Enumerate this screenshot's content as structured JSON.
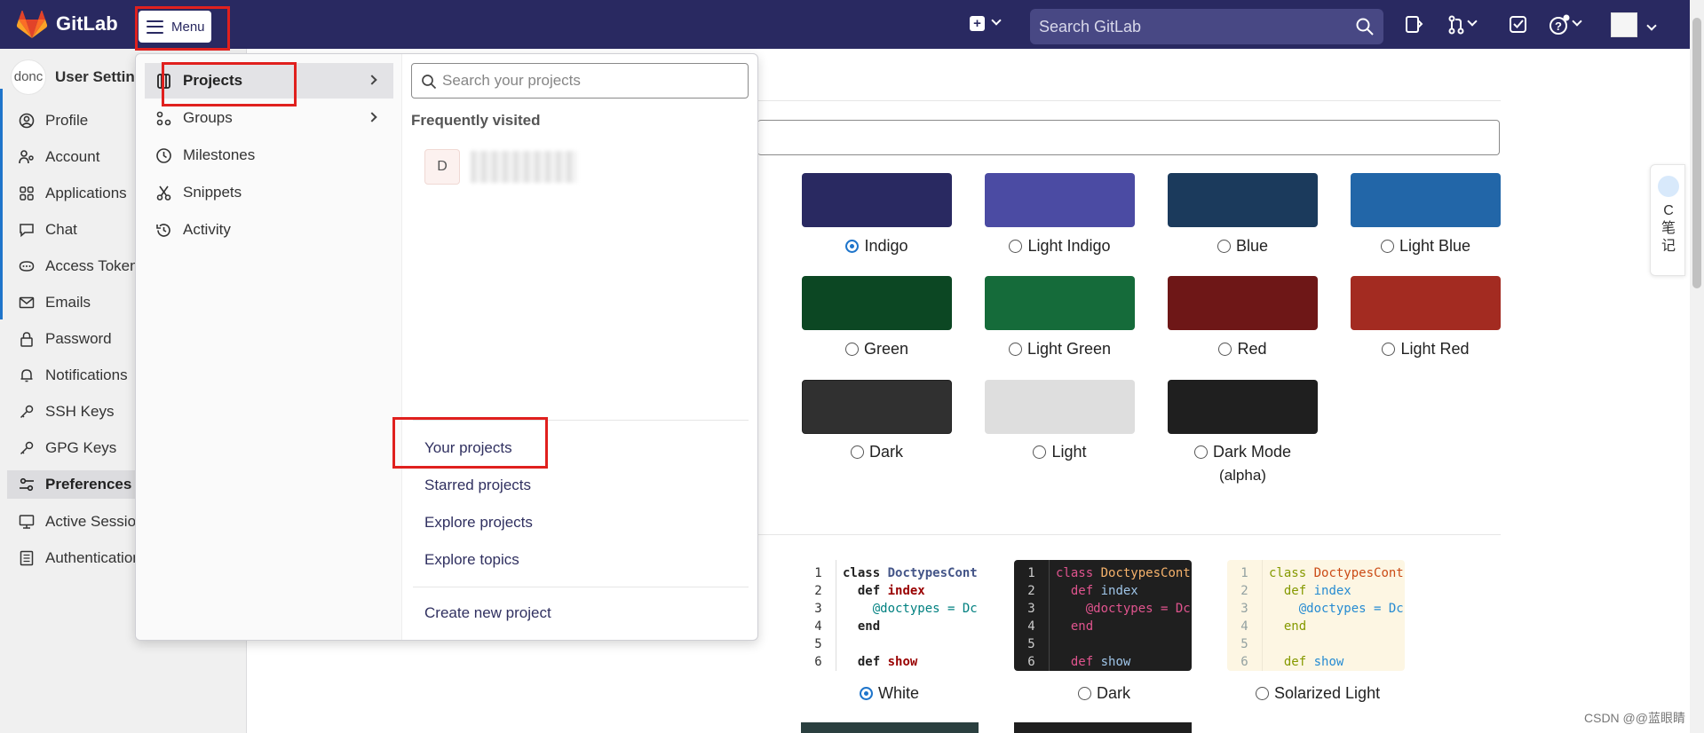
{
  "topbar": {
    "brand": "GitLab",
    "menu_label": "Menu",
    "search_placeholder": "Search GitLab"
  },
  "sidebar": {
    "user_title": "User Settings",
    "avatar_text": "donc",
    "items": [
      {
        "label": "Profile"
      },
      {
        "label": "Account"
      },
      {
        "label": "Applications"
      },
      {
        "label": "Chat"
      },
      {
        "label": "Access Tokens"
      },
      {
        "label": "Emails"
      },
      {
        "label": "Password"
      },
      {
        "label": "Notifications"
      },
      {
        "label": "SSH Keys"
      },
      {
        "label": "GPG Keys"
      },
      {
        "label": "Preferences"
      },
      {
        "label": "Active Sessions"
      },
      {
        "label": "Authentication"
      }
    ]
  },
  "menu": {
    "items": [
      {
        "label": "Projects"
      },
      {
        "label": "Groups"
      },
      {
        "label": "Milestones"
      },
      {
        "label": "Snippets"
      },
      {
        "label": "Activity"
      }
    ],
    "search_placeholder": "Search your projects",
    "frequently_visited": "Frequently visited",
    "frequent_project_initial": "D",
    "links": {
      "your_projects": "Your projects",
      "starred_projects": "Starred projects",
      "explore_projects": "Explore projects",
      "explore_topics": "Explore topics",
      "create_new_project": "Create new project"
    }
  },
  "themes": [
    {
      "label": "Indigo",
      "color": "#292961",
      "selected": true
    },
    {
      "label": "Light Indigo",
      "color": "#4b4ba3",
      "selected": false
    },
    {
      "label": "Blue",
      "color": "#1b3a5c",
      "selected": false
    },
    {
      "label": "Light Blue",
      "color": "#2266a8",
      "selected": false
    },
    {
      "label": "Green",
      "color": "#0c4723",
      "selected": false
    },
    {
      "label": "Light Green",
      "color": "#156b3a",
      "selected": false
    },
    {
      "label": "Red",
      "color": "#6e1717",
      "selected": false
    },
    {
      "label": "Light Red",
      "color": "#a32b21",
      "selected": false
    },
    {
      "label": "Dark",
      "color": "#303030",
      "selected": false
    },
    {
      "label": "Light",
      "color": "#dedede",
      "selected": false
    },
    {
      "label": "Dark Mode",
      "label2": "(alpha)",
      "color": "#1f1f1f",
      "selected": false
    }
  ],
  "syntax": {
    "white": "White",
    "dark": "Dark",
    "solarized_light": "Solarized Light",
    "lines": [
      "1",
      "2",
      "3",
      "4",
      "5",
      "6"
    ],
    "code_class": "class",
    "code_classname": "DoctypesCont",
    "code_def": "def",
    "code_index": "index",
    "code_ivar": "@doctypes",
    "code_assign": " = Dc",
    "code_end": "end",
    "code_show": "show"
  },
  "csdn": {
    "float_text": "C\n笔\n记",
    "watermark": "CSDN @@蓝眼睛"
  }
}
